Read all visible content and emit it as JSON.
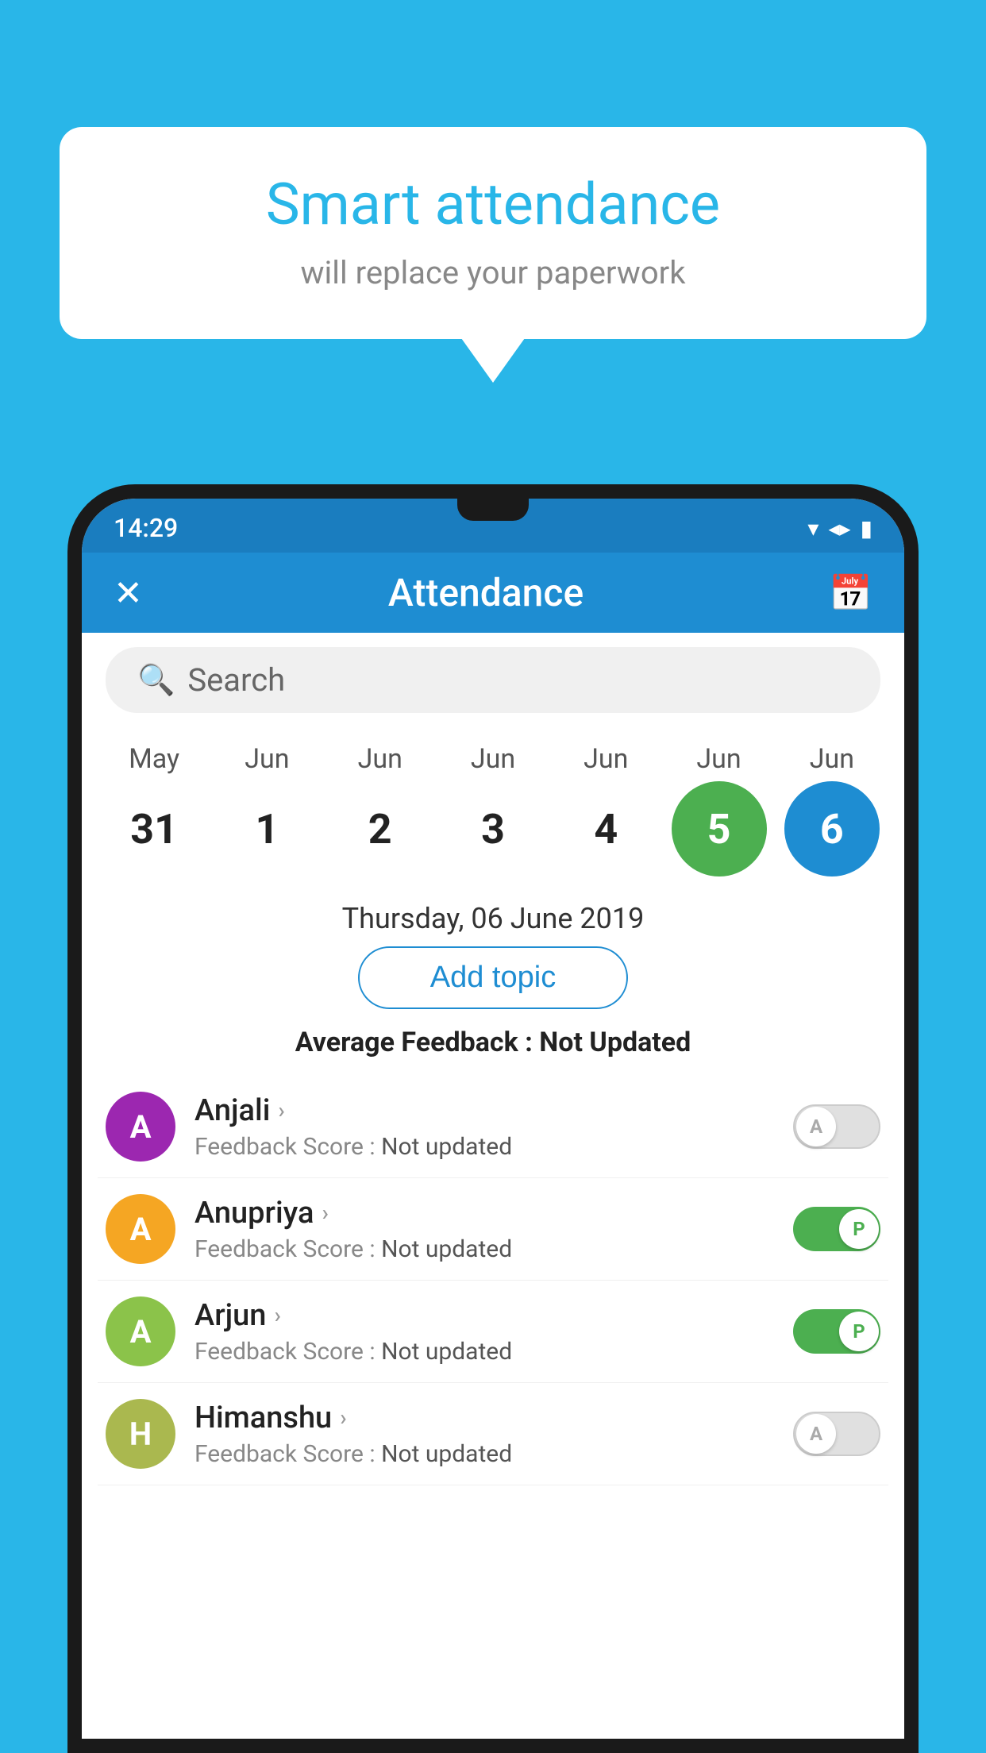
{
  "background_color": "#29b6e8",
  "bubble": {
    "title": "Smart attendance",
    "subtitle": "will replace your paperwork"
  },
  "status_bar": {
    "time": "14:29",
    "icons": [
      "wifi",
      "signal",
      "battery"
    ]
  },
  "app_bar": {
    "title": "Attendance",
    "close_icon": "✕",
    "calendar_icon": "📅"
  },
  "search": {
    "placeholder": "Search"
  },
  "calendar": {
    "months": [
      "May",
      "Jun",
      "Jun",
      "Jun",
      "Jun",
      "Jun",
      "Jun"
    ],
    "dates": [
      "31",
      "1",
      "2",
      "3",
      "4",
      "5",
      "6"
    ],
    "today_index": 5,
    "selected_index": 6
  },
  "selected_date_label": "Thursday, 06 June 2019",
  "add_topic_label": "Add topic",
  "avg_feedback_label": "Average Feedback : ",
  "avg_feedback_value": "Not Updated",
  "students": [
    {
      "name": "Anjali",
      "initial": "A",
      "avatar_color": "#9c27b0",
      "feedback_label": "Feedback Score : ",
      "feedback_value": "Not updated",
      "toggle_state": "off",
      "toggle_letter": "A"
    },
    {
      "name": "Anupriya",
      "initial": "A",
      "avatar_color": "#f5a623",
      "feedback_label": "Feedback Score : ",
      "feedback_value": "Not updated",
      "toggle_state": "on",
      "toggle_letter": "P"
    },
    {
      "name": "Arjun",
      "initial": "A",
      "avatar_color": "#8bc34a",
      "feedback_label": "Feedback Score : ",
      "feedback_value": "Not updated",
      "toggle_state": "on",
      "toggle_letter": "P"
    },
    {
      "name": "Himanshu",
      "initial": "H",
      "avatar_color": "#aab84f",
      "feedback_label": "Feedback Score : ",
      "feedback_value": "Not updated",
      "toggle_state": "off",
      "toggle_letter": "A"
    }
  ]
}
